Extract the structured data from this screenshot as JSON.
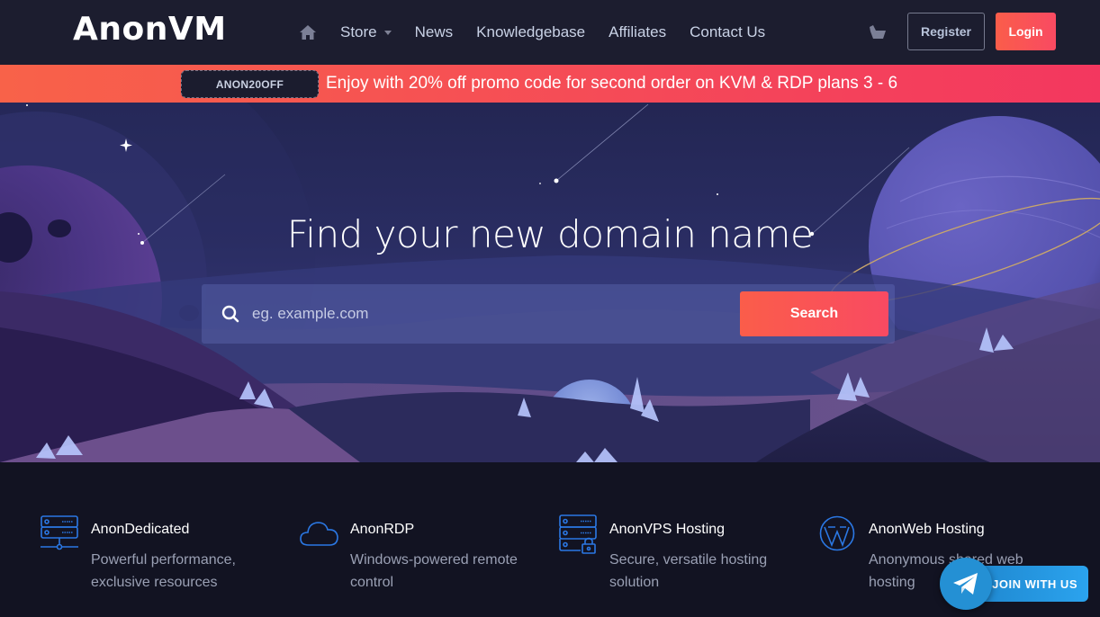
{
  "header": {
    "logo": "AnonVM",
    "nav": [
      {
        "label": "Store",
        "has_dropdown": true
      },
      {
        "label": "News"
      },
      {
        "label": "Knowledgebase"
      },
      {
        "label": "Affiliates"
      },
      {
        "label": "Contact Us"
      }
    ],
    "register_label": "Register",
    "login_label": "Login"
  },
  "promo": {
    "code": "ANON20OFF",
    "text": "Enjoy with 20% off promo code for second order on KVM & RDP plans 3 - 6"
  },
  "hero": {
    "title": "Find your new domain name",
    "search_placeholder": "eg. example.com",
    "search_value": "",
    "search_button": "Search"
  },
  "features": [
    {
      "icon": "server-icon",
      "title": "AnonDedicated",
      "description": "Powerful performance, exclusive resources"
    },
    {
      "icon": "cloud-icon",
      "title": "AnonRDP",
      "description": "Windows-powered remote control"
    },
    {
      "icon": "secure-server-icon",
      "title": "AnonVPS Hosting",
      "description": "Secure, versatile hosting solution"
    },
    {
      "icon": "wordpress-icon",
      "title": "AnonWeb Hosting",
      "description": "Anonymous shared web hosting"
    }
  ],
  "telegram": {
    "label": "JOIN WITH US"
  },
  "colors": {
    "accent": "#f9554f",
    "icon_blue": "#2b78e4",
    "telegram": "#2490d4",
    "header_bg": "#1c1d2f"
  }
}
